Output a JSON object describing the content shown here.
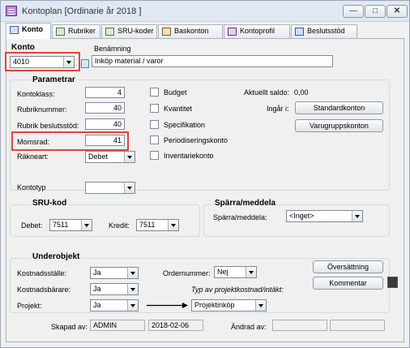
{
  "window": {
    "title": "Kontoplan [Ordinarie år 2018 ]",
    "accent": "#e0463c"
  },
  "tabs": [
    "Konto",
    "Rubriker",
    "SRU-koder",
    "Baskonton",
    "Kontoprofil",
    "Beslutsstöd"
  ],
  "header": {
    "konto_label": "Konto",
    "konto_value": "4010",
    "benamning_label": "Benämning",
    "benamning_value": "Inköp material / varor"
  },
  "parametrar": {
    "title": "Parametrar",
    "kontoklass_label": "Kontoklass:",
    "kontoklass_value": "4",
    "rubriknummer_label": "Rubriknummer:",
    "rubriknummer_value": "40",
    "rubrik_beslutsstod_label": "Rubrik beslutsstöd:",
    "rubrik_beslutsstod_value": "40",
    "momsrad_label": "Momsrad:",
    "momsrad_value": "41",
    "rakneart_label": "Räkneart:",
    "rakneart_value": "Debet",
    "kontotyp_label": "Kontotyp",
    "kontotyp_value": "",
    "checkboxes": [
      "Budget",
      "Kvantitet",
      "Specifikation",
      "Periodiseringskonto",
      "Inventariekonto"
    ],
    "aktuellt_saldo_label": "Aktuellt saldo:",
    "aktuellt_saldo_value": "0,00",
    "ingar_i_label": "Ingår i:",
    "standardkonton_button": "Standardkonton",
    "varugruppskonton_button": "Varugruppskonton"
  },
  "sru": {
    "title": "SRU-kod",
    "debet_label": "Debet:",
    "debet_value": "7511",
    "kredit_label": "Kredit:",
    "kredit_value": "7511"
  },
  "sparra": {
    "title": "Spärra/meddela",
    "label": "Spärra/meddela:",
    "value": "<Inget>"
  },
  "underobjekt": {
    "title": "Underobjekt",
    "kostnadsstalle_label": "Kostnadsställe:",
    "kostnadsstalle_value": "Ja",
    "kostnadsbarare_label": "Kostnadsbärare:",
    "kostnadsbarare_value": "Ja",
    "projekt_label": "Projekt:",
    "projekt_value": "Ja",
    "ordernummer_label": "Ordernummer:",
    "ordernummer_value": "Nej",
    "typ_label": "Typ av projektkostnad/intäkt:",
    "typ_value": "Projektinköp",
    "oversattning_button": "Översättning",
    "kommentar_button": "Kommentar"
  },
  "footer": {
    "skapad_label": "Skapad av:",
    "skapad_user": "ADMIN",
    "skapad_date": "2018-02-06",
    "andrad_label": "Ändrad av:",
    "andrad_user": "",
    "andrad_date": ""
  }
}
